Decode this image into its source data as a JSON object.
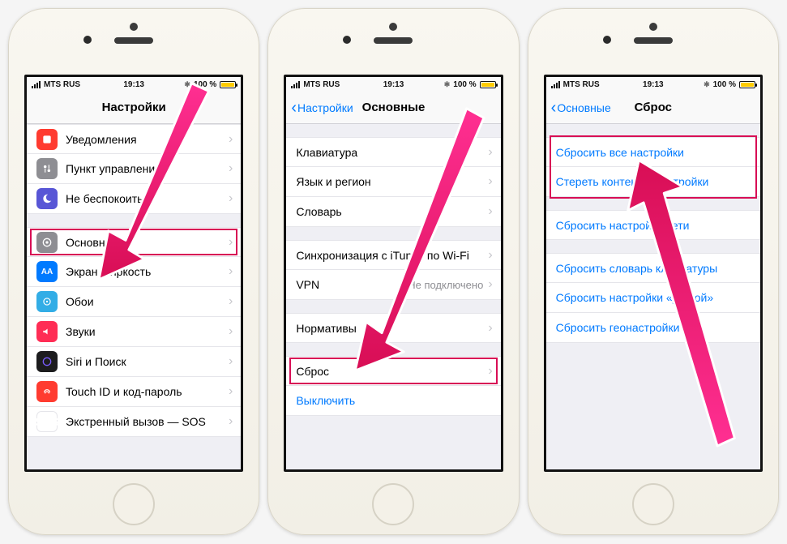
{
  "statusbar": {
    "carrier": "MTS RUS",
    "time": "19:13",
    "battery_text": "100 %"
  },
  "phone1": {
    "title": "Настройки",
    "rows": {
      "notifications": "Уведомления",
      "control": "Пункт управления",
      "dnd": "Не беспокоить",
      "general": "Основные",
      "display": "Экран и яркость",
      "wallpaper": "Обои",
      "sounds": "Звуки",
      "siri": "Siri и Поиск",
      "touchid": "Touch ID и код-пароль",
      "sos": "Экстренный вызов — SOS"
    }
  },
  "phone2": {
    "back": "Настройки",
    "title": "Основные",
    "rows": {
      "keyboard": "Клавиатура",
      "lang": "Язык и регион",
      "dict": "Словарь",
      "itunes": "Синхронизация с iTunes по Wi-Fi",
      "vpn": "VPN",
      "vpn_value": "Не подключено",
      "norm": "Нормативы",
      "reset": "Сброс",
      "shutdown": "Выключить"
    }
  },
  "phone3": {
    "back": "Основные",
    "title": "Сброс",
    "rows": {
      "reset_all": "Сбросить все настройки",
      "erase": "Стереть контент и настройки",
      "reset_net": "Сбросить настройки сети",
      "reset_dict": "Сбросить словарь клавиатуры",
      "reset_home": "Сбросить настройки «Домой»",
      "reset_geo": "Сбросить геонастройки"
    }
  }
}
